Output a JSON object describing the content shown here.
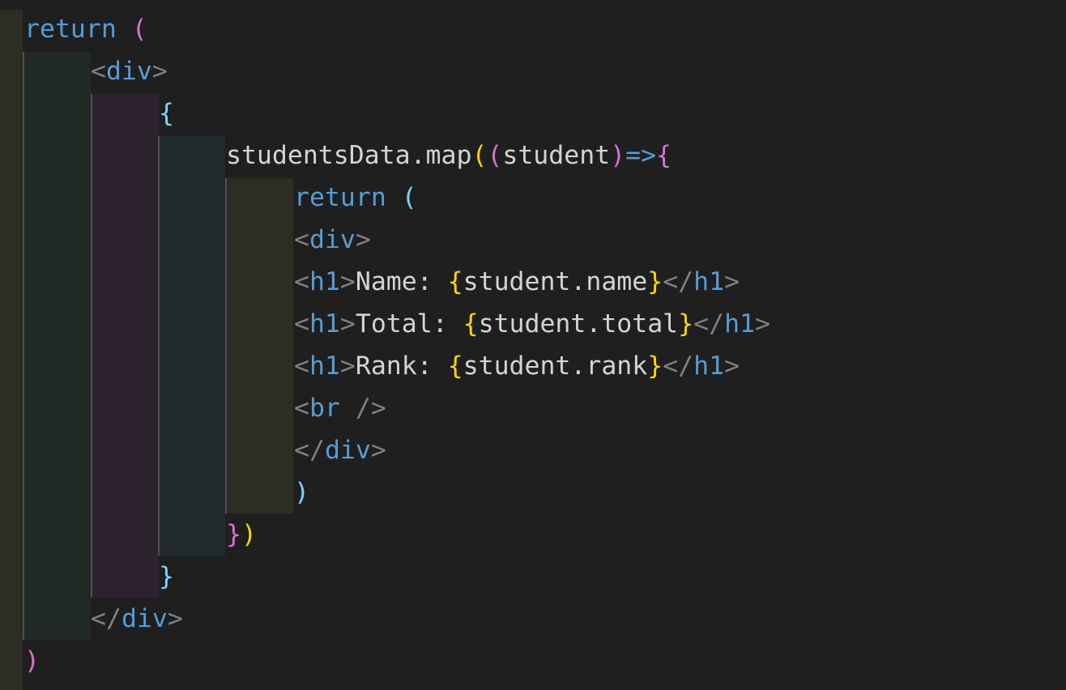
{
  "editor": {
    "colors": {
      "background": "#1f1f1f",
      "keyword": "#569cd6",
      "bracket_gray": "#808080",
      "text": "#d4d4d4",
      "bracket_gold": "#ffd700",
      "bracket_orchid": "#da70d6",
      "bracket_blue": "#179fff"
    },
    "code_lines": [
      [
        "return",
        " ",
        "("
      ],
      [
        "<",
        "div",
        ">"
      ],
      [
        "{"
      ],
      [
        "studentsData.map",
        "(",
        "(",
        "student",
        ")",
        "=>",
        "{"
      ],
      [
        "return",
        " ",
        "("
      ],
      [
        "<",
        "div",
        ">"
      ],
      [
        "<",
        "h1",
        ">",
        "Name: ",
        "{",
        "student.name",
        "}",
        "</",
        "h1",
        ">"
      ],
      [
        "<",
        "h1",
        ">",
        "Total: ",
        "{",
        "student.total",
        "}",
        "</",
        "h1",
        ">"
      ],
      [
        "<",
        "h1",
        ">",
        "Rank: ",
        "{",
        "student.rank",
        "}",
        "</",
        "h1",
        ">"
      ],
      [
        "<",
        "br",
        " />"
      ],
      [
        "</",
        "div",
        ">"
      ],
      [
        ")"
      ],
      [
        "}",
        ")"
      ],
      [
        "}"
      ],
      [
        "</",
        "div",
        ">"
      ],
      [
        ")"
      ]
    ]
  }
}
